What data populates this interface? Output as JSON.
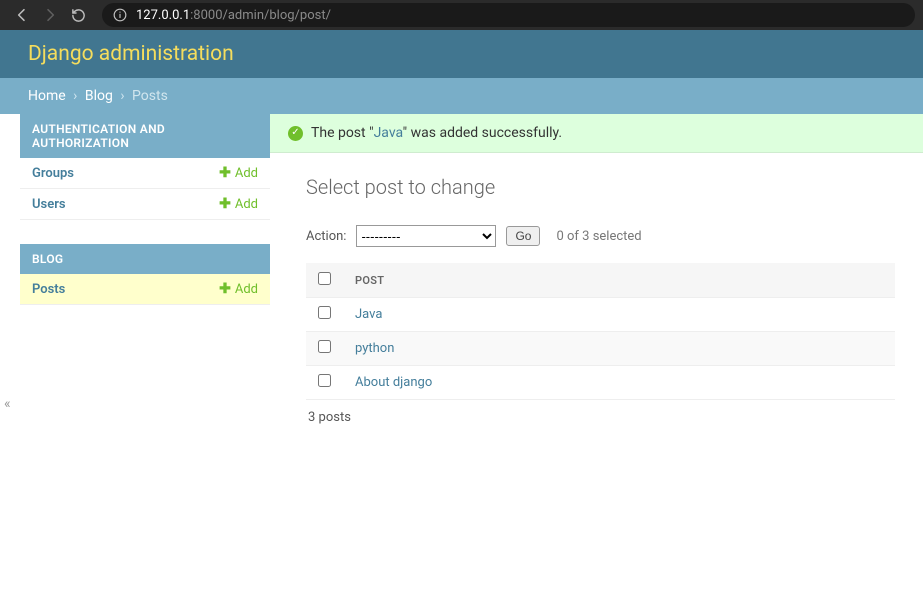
{
  "browser": {
    "url_host": "127.0.0.1",
    "url_rest": ":8000/admin/blog/post/"
  },
  "header": {
    "title": "Django administration"
  },
  "breadcrumbs": {
    "home": "Home",
    "sep": "›",
    "app": "Blog",
    "current": "Posts"
  },
  "sidebar": {
    "modules": [
      {
        "title": "AUTHENTICATION AND AUTHORIZATION",
        "items": [
          {
            "label": "Groups",
            "add": "Add"
          },
          {
            "label": "Users",
            "add": "Add"
          }
        ]
      },
      {
        "title": "BLOG",
        "items": [
          {
            "label": "Posts",
            "add": "Add",
            "current": true
          }
        ]
      }
    ]
  },
  "message": {
    "pre": "The post \"",
    "link": "Java",
    "post": "\" was added successfully."
  },
  "content": {
    "title": "Select post to change",
    "action_label": "Action:",
    "action_placeholder": "---------",
    "go_label": "Go",
    "counter": "0 of 3 selected",
    "column_header": "POST",
    "rows": [
      {
        "title": "Java"
      },
      {
        "title": "python"
      },
      {
        "title": "About django"
      }
    ],
    "paginator": "3 posts"
  },
  "collapse_glyph": "«"
}
